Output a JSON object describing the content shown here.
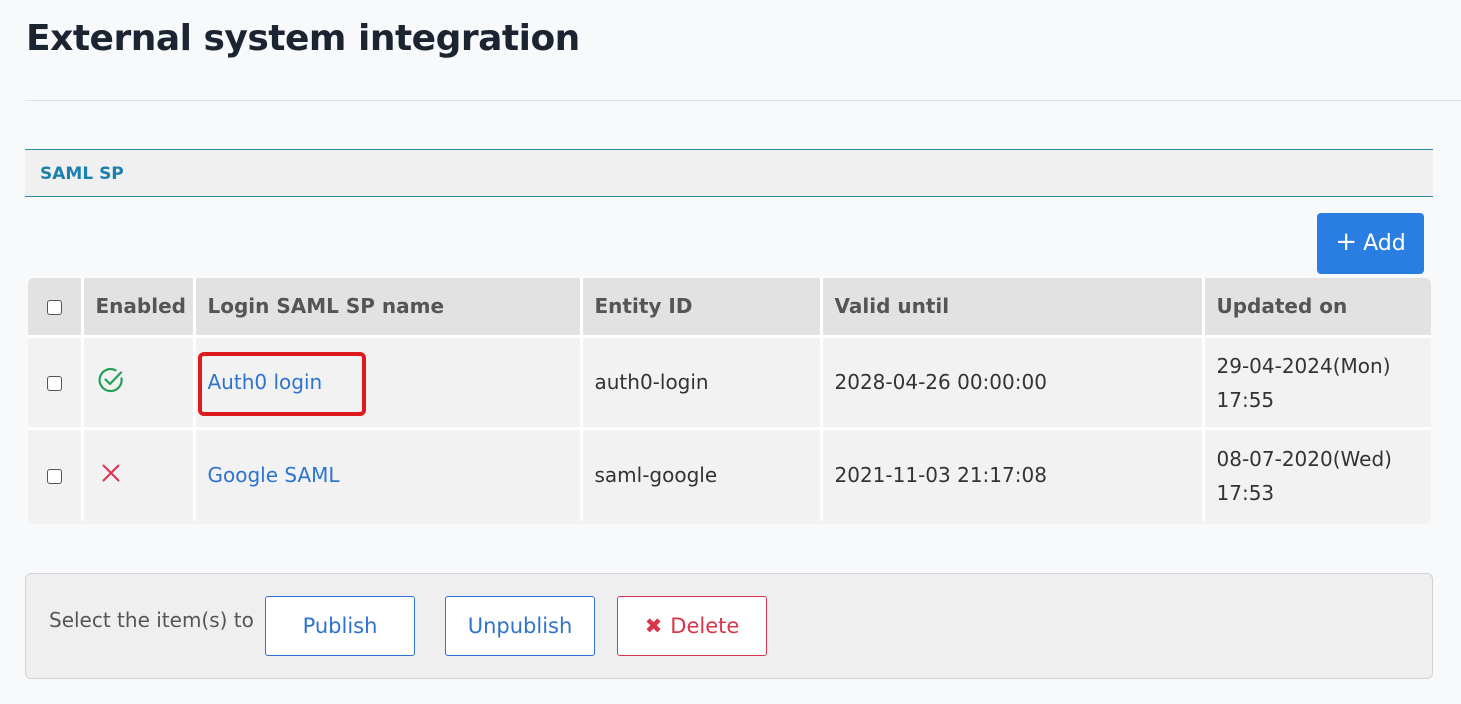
{
  "page": {
    "title": "External system integration"
  },
  "section": {
    "label": "SAML SP"
  },
  "toolbar": {
    "add_label": "Add",
    "add_icon": "plus-icon"
  },
  "table": {
    "headers": {
      "enabled": "Enabled",
      "name": "Login SAML SP name",
      "entity_id": "Entity ID",
      "valid_until": "Valid until",
      "updated_on": "Updated on"
    },
    "rows": [
      {
        "checked": false,
        "enabled": true,
        "enabled_icon": "check-circle-icon",
        "name": "Auth0 login",
        "entity_id": "auth0-login",
        "valid_until": "2028-04-26 00:00:00",
        "updated_date": "29-04-2024(Mon)",
        "updated_time": "17:55"
      },
      {
        "checked": false,
        "enabled": false,
        "enabled_icon": "x-mark-icon",
        "name": "Google SAML",
        "entity_id": "saml-google",
        "valid_until": "2021-11-03 21:17:08",
        "updated_date": "08-07-2020(Wed)",
        "updated_time": "17:53"
      }
    ]
  },
  "actions": {
    "label": "Select the item(s) to",
    "publish": "Publish",
    "unpublish": "Unpublish",
    "delete": "Delete"
  },
  "colors": {
    "accent": "#2a7de1",
    "link": "#2e73d0",
    "section_text": "#1d7fb0",
    "enabled_green": "#22a05a",
    "disabled_red": "#e0304a",
    "highlight": "#e0191e"
  }
}
